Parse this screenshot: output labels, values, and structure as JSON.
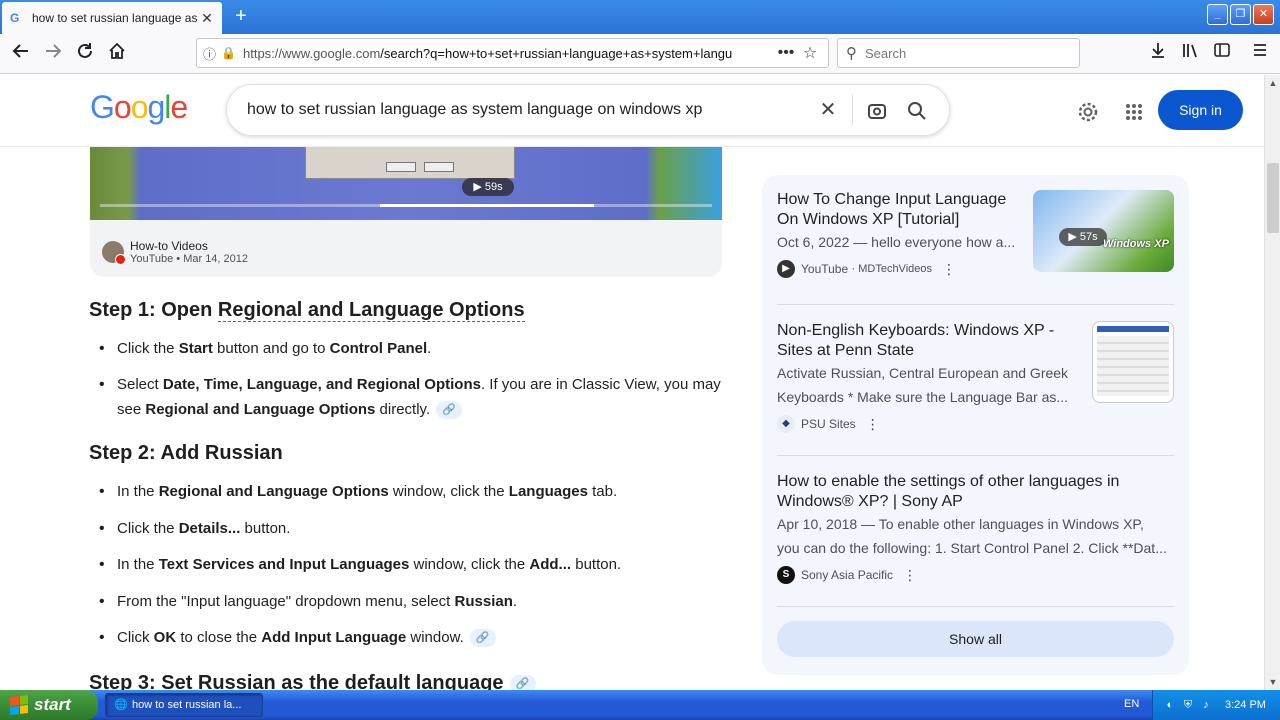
{
  "browser": {
    "tab_title": "how to set russian language as sy",
    "url_host": "https://www.google.com",
    "url_path": "/search?q=how+to+set+russian+language+as+system+langu",
    "search_placeholder": "Search"
  },
  "google": {
    "query": "how to set russian language as system language on windows xp",
    "sign_in": "Sign in"
  },
  "video": {
    "duration": "59s",
    "channel": "How-to Videos",
    "meta": "YouTube • Mar 14, 2012"
  },
  "steps": [
    {
      "heading_prefix": "Step 1: Open ",
      "heading_link": "Regional and Language Options",
      "items": [
        {
          "parts": [
            "Click the ",
            "Start",
            " button and go to ",
            "Control Panel",
            "."
          ]
        },
        {
          "parts": [
            "Select ",
            "Date, Time, Language, and Regional Options",
            ". If you are in Classic View, you may see ",
            "Regional and Language Options",
            " directly."
          ]
        }
      ]
    },
    {
      "heading_prefix": "Step 2: Add Russian",
      "items": [
        {
          "parts": [
            "In the ",
            "Regional and Language Options",
            " window, click the ",
            "Languages",
            " tab."
          ]
        },
        {
          "parts": [
            "Click the ",
            "Details...",
            " button."
          ]
        },
        {
          "parts": [
            "In the ",
            "Text Services and Input Languages",
            " window, click the ",
            "Add...",
            " button."
          ]
        },
        {
          "parts": [
            "From the \"Input language\" dropdown menu, select ",
            "Russian",
            "."
          ]
        },
        {
          "parts": [
            "Click ",
            "OK",
            " to close the ",
            "Add Input Language",
            " window."
          ]
        }
      ]
    },
    {
      "heading_prefix": "Step 3: Set Russian as the default language"
    }
  ],
  "related": [
    {
      "title": "How To Change Input Language On Windows XP [Tutorial]",
      "snippet": "Oct 6, 2022 — hello everyone how a...",
      "source": "YouTube",
      "source_sub": "· MDTechVideos",
      "duration": "57s",
      "thumb_text": "Windows XP"
    },
    {
      "title": "Non-English Keyboards: Windows XP - Sites at Penn State",
      "snippet": "Activate Russian, Central European and Greek",
      "snippet2": "Keyboards * Make sure the Language Bar as...",
      "source": "PSU Sites"
    },
    {
      "title": "How to enable the settings of other languages in Windows® XP? | Sony AP",
      "snippet": "Apr 10, 2018 — To enable other languages in Windows XP,",
      "snippet2": "you can do the following: 1. Start Control Panel 2. Click **Dat...",
      "source": "Sony Asia Pacific"
    }
  ],
  "show_all": "Show all",
  "taskbar": {
    "start": "start",
    "task_title": "how to set russian la...",
    "lang": "EN",
    "clock": "3:24 PM"
  }
}
